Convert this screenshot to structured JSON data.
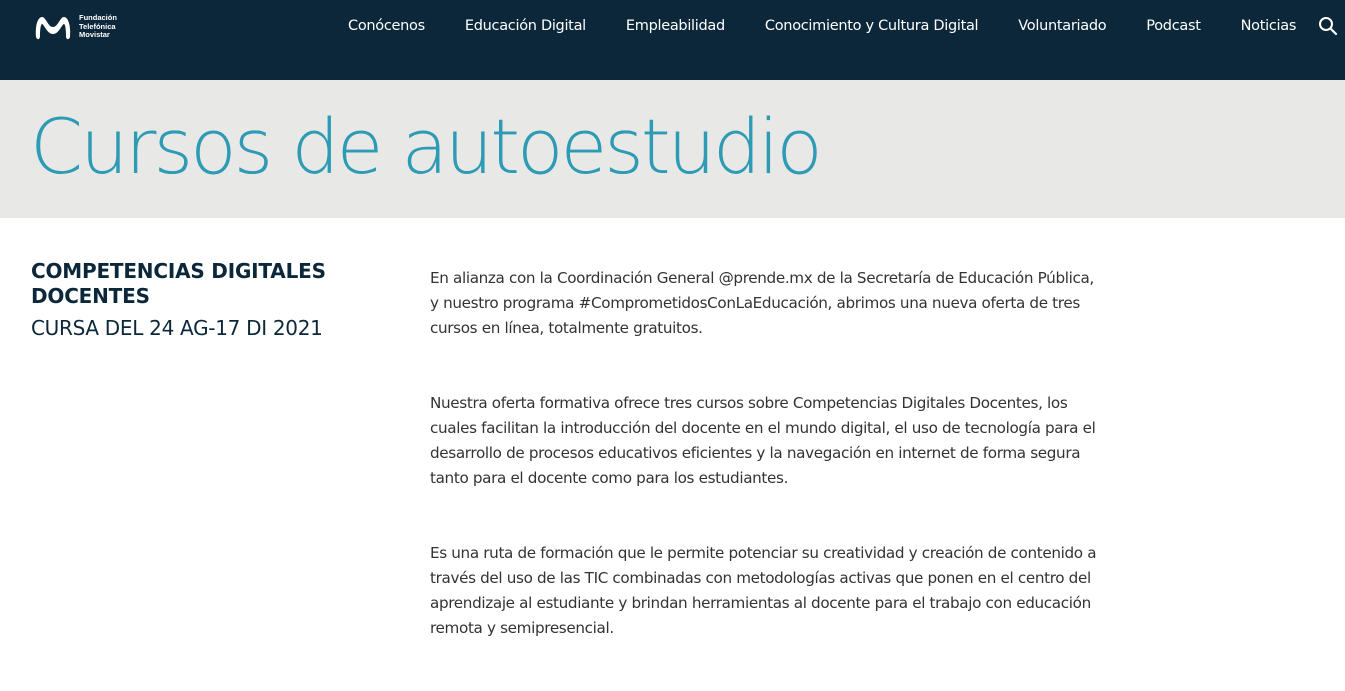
{
  "header": {
    "logo_lines": [
      "Fundación",
      "Telefónica",
      "Movistar"
    ],
    "nav": [
      {
        "label": "Conócenos"
      },
      {
        "label": "Educación Digital"
      },
      {
        "label": "Empleabilidad"
      },
      {
        "label": "Conocimiento y Cultura Digital"
      },
      {
        "label": "Voluntariado"
      },
      {
        "label": "Podcast"
      },
      {
        "label": "Noticias"
      }
    ],
    "search_icon": "search-icon",
    "brand_color": "#0b2739"
  },
  "hero": {
    "title": "Cursos de autoestudio",
    "title_color": "#2e9bb5",
    "background": "#e8e8e7"
  },
  "sidebar": {
    "heading": "COMPETENCIAS DIGITALES DOCENTES",
    "subheading": "CURSA DEL 24 AG-17 DI 2021"
  },
  "article": {
    "paragraphs": [
      "En alianza con la Coordinación General @prende.mx de la Secretaría de Educación Pública, y nuestro programa #ComprometidosConLaEducación, abrimos una nueva oferta de tres cursos en línea, totalmente gratuitos.",
      "Nuestra oferta formativa ofrece tres cursos sobre Competencias Digitales Docentes, los cuales facilitan la introducción del docente en el mundo digital, el uso de tecnología para el desarrollo de procesos educativos eficientes y la navegación en internet de forma segura tanto para el docente como para los estudiantes.",
      "Es una ruta de formación que le permite potenciar su creatividad y creación de contenido a través del uso de las TIC combinadas con metodologías activas que ponen en el centro del aprendizaje al estudiante y brindan herramientas al docente para el trabajo con educación remota y semipresencial."
    ]
  }
}
